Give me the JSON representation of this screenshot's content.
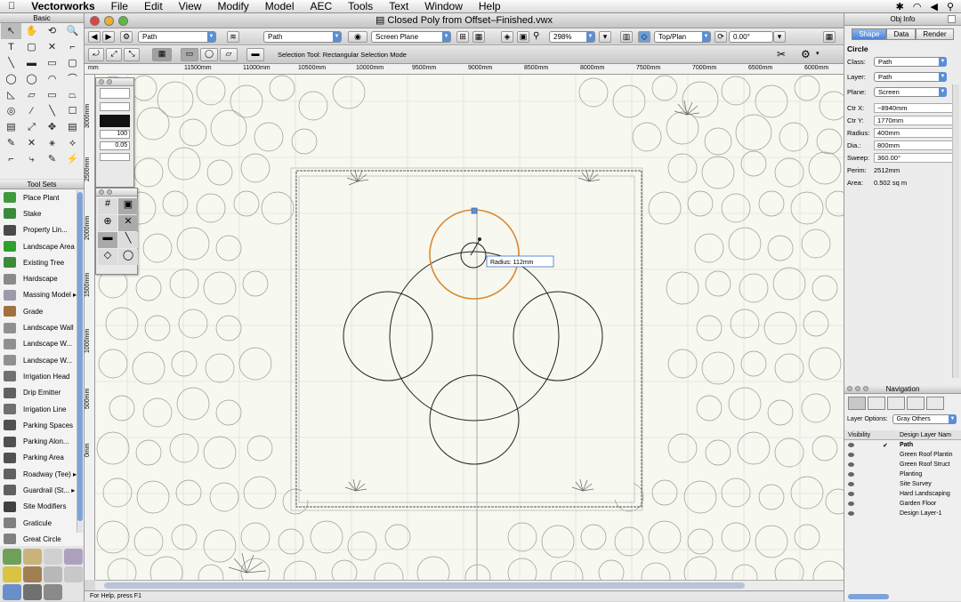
{
  "menubar": {
    "apple": "",
    "app": "Vectorworks",
    "items": [
      "File",
      "Edit",
      "View",
      "Modify",
      "Model",
      "AEC",
      "Tools",
      "Text",
      "Window",
      "Help"
    ]
  },
  "window": {
    "title": "Closed Poly from Offset–Finished.vwx"
  },
  "toolbar": {
    "class_value": "Path",
    "layer_value": "Path",
    "plane_value": "Screen Plane",
    "zoom_value": "298%",
    "view_value": "Top/Plan",
    "rotation_value": "0.00°"
  },
  "mode_bar": {
    "message": "Selection Tool: Rectangular Selection Mode"
  },
  "ruler_top": {
    "ticks": [
      "mm",
      "11500mm",
      "11000mm",
      "10500mm",
      "10000mm",
      "9500mm",
      "9000mm",
      "8500mm",
      "8000mm",
      "7500mm",
      "7000mm",
      "6500mm",
      "6000mm"
    ]
  },
  "ruler_left": {
    "ticks": [
      "3000mm",
      "2500mm",
      "2000mm",
      "1500mm",
      "1000mm",
      "500mm",
      "0mm"
    ]
  },
  "drawing": {
    "radius_tooltip": "Radius:  112mm"
  },
  "basic_palette": {
    "title": "Basic",
    "tools": [
      "↖",
      "✋",
      "⟲",
      "🔍",
      "T",
      "▢",
      "✕",
      "⌐",
      "╲",
      "▬",
      "▭",
      "▢",
      "◯",
      "◯",
      "◠",
      "⌒",
      "◺",
      "▱",
      "▭",
      "⏢",
      "◎",
      "⁄",
      "╲",
      "☐",
      "▤",
      "⤢",
      "✥",
      "▤",
      "✎",
      "✕",
      "⚹",
      "⟡",
      "⌐",
      "⤷",
      "✎",
      "⚡"
    ]
  },
  "tool_sets": {
    "title": "Tool Sets",
    "items": [
      {
        "label": "Place Plant",
        "color": "#3d9a3d"
      },
      {
        "label": "Stake",
        "color": "#3a8a3a"
      },
      {
        "label": "Property Lin...",
        "color": "#4a4a4a"
      },
      {
        "label": "Landscape Area",
        "color": "#2ea02e"
      },
      {
        "label": "Existing Tree",
        "color": "#3b8b3b"
      },
      {
        "label": "Hardscape",
        "color": "#8a8a8a"
      },
      {
        "label": "Massing Model ▸",
        "color": "#9a9aa8"
      },
      {
        "label": "Grade",
        "color": "#a07040"
      },
      {
        "label": "Landscape Wall",
        "color": "#909090"
      },
      {
        "label": "Landscape W...",
        "color": "#909090"
      },
      {
        "label": "Landscape W...",
        "color": "#909090"
      },
      {
        "label": "Irrigation Head",
        "color": "#707070"
      },
      {
        "label": "Drip Emitter",
        "color": "#606060"
      },
      {
        "label": "Irrigation Line",
        "color": "#707070"
      },
      {
        "label": "Parking Spaces",
        "color": "#505050"
      },
      {
        "label": "Parking Alon...",
        "color": "#505050"
      },
      {
        "label": "Parking Area",
        "color": "#505050"
      },
      {
        "label": "Roadway (Tee) ▸",
        "color": "#606060"
      },
      {
        "label": "Guardrail (St... ▸",
        "color": "#606060"
      },
      {
        "label": "Site Modifiers",
        "color": "#404040"
      },
      {
        "label": "Graticule",
        "color": "#808080"
      },
      {
        "label": "Great Circle",
        "color": "#808080"
      }
    ]
  },
  "obj_info": {
    "title": "Obj Info",
    "tabs": [
      "Shape",
      "Data",
      "Render"
    ],
    "shape_type": "Circle",
    "class_label": "Class:",
    "class_value": "Path",
    "layer_label": "Layer:",
    "layer_value": "Path",
    "plane_label": "Plane:",
    "plane_value": "Screen",
    "fields": [
      {
        "label": "Ctr X:",
        "value": "−8940mm"
      },
      {
        "label": "Ctr Y:",
        "value": "1770mm"
      },
      {
        "label": "Radius:",
        "value": "400mm"
      },
      {
        "label": "Dia.:",
        "value": "800mm"
      },
      {
        "label": "Sweep:",
        "value": "360.00°"
      }
    ],
    "perim_label": "Perim:",
    "perim_value": "2512mm",
    "area_label": "Area:",
    "area_value": "0.502 sq m"
  },
  "navigation": {
    "title": "Navigation",
    "layer_options_label": "Layer Options:",
    "layer_options_value": "Gray Others",
    "col_visibility": "Visibility",
    "col_name": "Design Layer Nam",
    "layers": [
      "Path",
      "Green Roof Plantin",
      "Green Roof Struct",
      "Planting",
      "Site Survey",
      "Hard Landscaping",
      "Garden Floor",
      "Design Layer-1"
    ]
  },
  "status": {
    "help": "For Help, press F1"
  }
}
